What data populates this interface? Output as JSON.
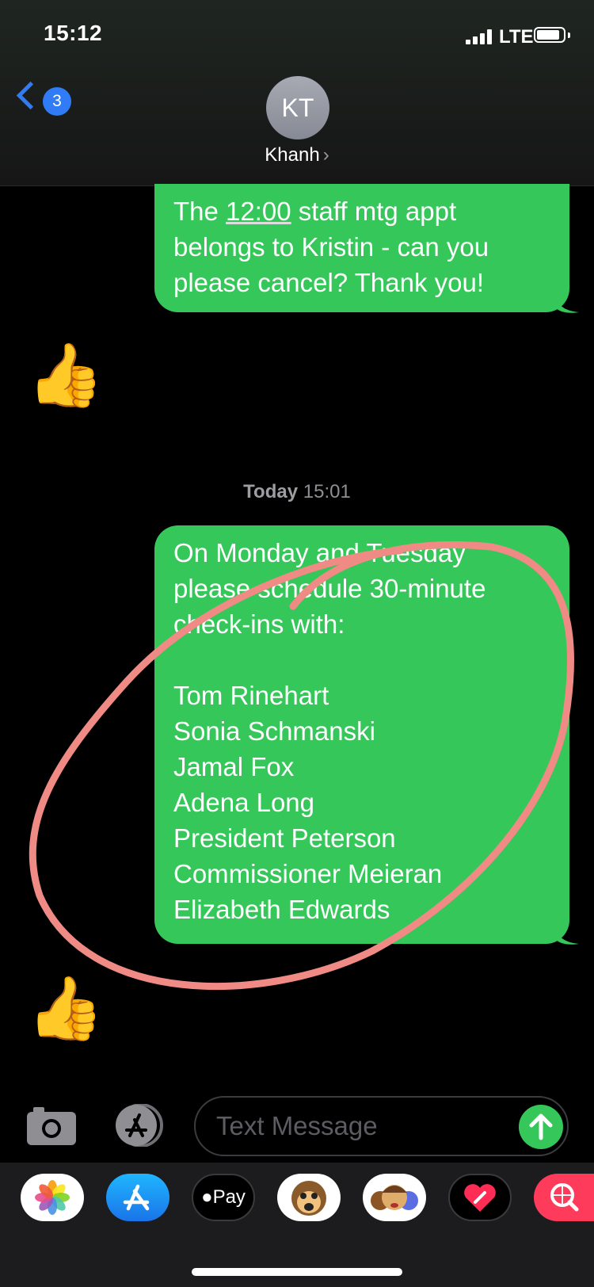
{
  "status_bar": {
    "time": "15:12",
    "network": "LTE"
  },
  "header": {
    "back_count": "3",
    "avatar_initials": "KT",
    "contact_name": "Khanh",
    "contact_chevron": "›"
  },
  "messages": {
    "first": {
      "pre": "The ",
      "link": "12:00",
      "post": " staff mtg appt",
      "line2": "belongs to Kristin - can you",
      "line3": "please cancel? Thank you!"
    },
    "reaction_1": "👍",
    "timestamp": {
      "day": "Today",
      "time": "15:01"
    },
    "second": {
      "intro": [
        "On Monday and Tuesday",
        "please schedule 30-minute",
        "check-ins with:"
      ],
      "names": [
        "Tom Rinehart",
        "Sonia Schmanski",
        "Jamal Fox",
        "Adena Long",
        "President Peterson",
        "Commissioner Meieran",
        "Elizabeth Edwards"
      ]
    },
    "reaction_2": "👍"
  },
  "input": {
    "placeholder": "Text Message"
  },
  "app_drawer": {
    "apple_pay_label": "Pay",
    "icons": [
      "photos-icon",
      "app-store-icon",
      "apple-pay-icon",
      "animoji-monkey-icon",
      "memoji-icon",
      "digital-touch-icon",
      "web-search-icon"
    ]
  },
  "colors": {
    "bubble": "#35c759",
    "accent": "#2f7cf6",
    "annotation": "#f08a85"
  }
}
